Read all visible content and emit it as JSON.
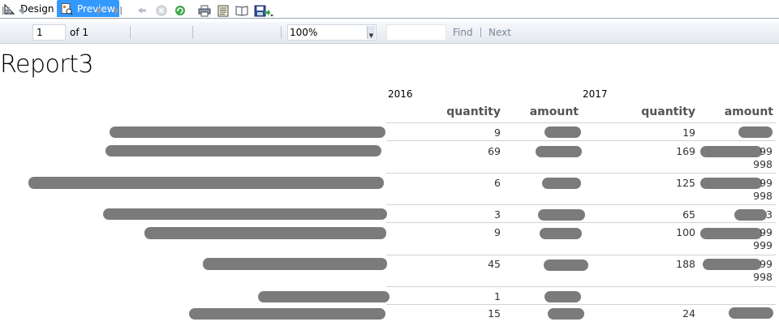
{
  "tabs": [
    {
      "label": "Design",
      "active": false
    },
    {
      "label": "Preview",
      "active": true
    }
  ],
  "toolbar": {
    "page_value": "1",
    "of_label": "of 1",
    "zoom_value": "100%",
    "find_label": "Find",
    "next_label": "Next"
  },
  "report": {
    "title": "Report3",
    "years": [
      "2016",
      "2017"
    ],
    "headers": {
      "q2016": "quantity",
      "a2016": "amount",
      "q2017": "quantity",
      "a2017": "amount"
    },
    "rows": [
      {
        "q2016": "9",
        "q2017": "19",
        "a2017_tail": ""
      },
      {
        "q2016": "69",
        "q2017": "169",
        "a2017_tail": "99",
        "a2017_line2": "998"
      },
      {
        "q2016": "6",
        "q2017": "125",
        "a2017_tail": "99",
        "a2017_line2": "998"
      },
      {
        "q2016": "3",
        "q2017": "65",
        "a2017_tail": "3"
      },
      {
        "q2016": "9",
        "q2017": "100",
        "a2017_tail": "99",
        "a2017_line2": "999"
      },
      {
        "q2016": "45",
        "q2017": "188",
        "a2017_tail": "99",
        "a2017_line2": "998"
      },
      {
        "q2016": "1",
        "q2017": "",
        "a2017_tail": ""
      },
      {
        "q2016": "15",
        "q2017": "24",
        "a2017_tail": ""
      }
    ]
  },
  "colors": {
    "preview_tab": "#3399ff",
    "redaction": "#7b7b7b"
  }
}
